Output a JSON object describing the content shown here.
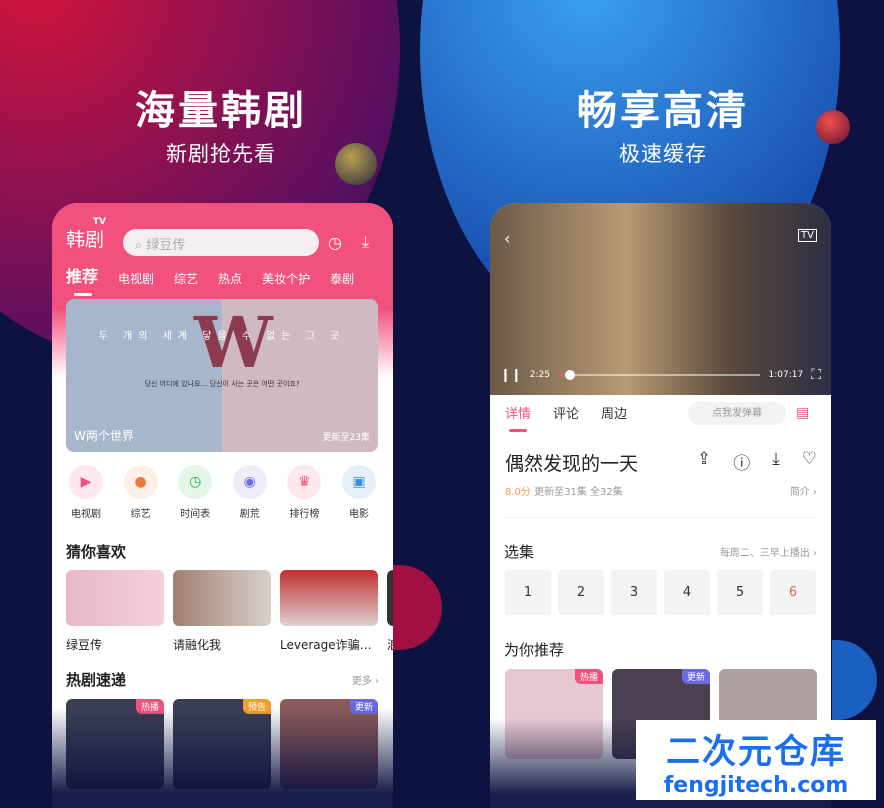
{
  "left": {
    "headline": "海量韩剧",
    "subhead": "新剧抢先看",
    "app": {
      "logo": "韩剧",
      "logo_tv": "TV",
      "search_placeholder": "绿豆传",
      "tabs": [
        "推荐",
        "电视剧",
        "综艺",
        "热点",
        "美妆个护",
        "泰剧"
      ],
      "banner": {
        "title": "W两个世界",
        "update": "更新至23集",
        "poster_letter": "W",
        "poster_line1": "두 개의 세계 닿을 수 없는 그 곳",
        "poster_line2": "당신 어디에 있나요… 당신이 사는 곳은 어떤 곳이죠?"
      },
      "categories": [
        {
          "label": "电视剧",
          "icon": "tv-icon",
          "color": "#f2517e"
        },
        {
          "label": "综艺",
          "icon": "microphone-icon",
          "color": "#f07840"
        },
        {
          "label": "时间表",
          "icon": "clock-icon",
          "color": "#22b04a"
        },
        {
          "label": "剧荒",
          "icon": "compass-icon",
          "color": "#6a6ae0"
        },
        {
          "label": "排行榜",
          "icon": "trophy-icon",
          "color": "#f0506a"
        },
        {
          "label": "电影",
          "icon": "film-icon",
          "color": "#3a90e0"
        }
      ],
      "guess_title": "猜你喜欢",
      "guess": [
        "绿豆传",
        "请融化我",
        "Leverage诈骗…",
        "浪"
      ],
      "hot_title": "热剧速递",
      "hot_more": "更多",
      "hot": [
        {
          "badge": "热播",
          "color": "#f2517e"
        },
        {
          "badge": "预告",
          "color": "#f0a030"
        },
        {
          "badge": "更新",
          "color": "#6a6ae0"
        }
      ]
    }
  },
  "right": {
    "headline": "畅享高清",
    "subhead": "极速缓存",
    "app": {
      "current_time": "2:25",
      "total_time": "1:07:17",
      "progress_percent": 3.6,
      "tabs": [
        "详情",
        "评论",
        "周边"
      ],
      "danmu_placeholder": "点我发弹幕",
      "title": "偶然发现的一天",
      "score": "8.0分",
      "update": "更新至31集",
      "total": "全32集",
      "intro": "简介",
      "episodes_title": "选集",
      "schedule": "每周二、三早上播出",
      "episodes": [
        "1",
        "2",
        "3",
        "4",
        "5",
        "6"
      ],
      "current_episode": "6",
      "recommend_title": "为你推荐",
      "recommend_badges": [
        {
          "badge": "热播",
          "color": "#f2517e"
        },
        {
          "badge": "更新",
          "color": "#6a6ae0"
        }
      ]
    }
  },
  "watermark": {
    "cn": "二次元仓库",
    "url": "fengjitech.com"
  },
  "colors": {
    "accent": "#f2517e",
    "background": "#0d1240"
  }
}
